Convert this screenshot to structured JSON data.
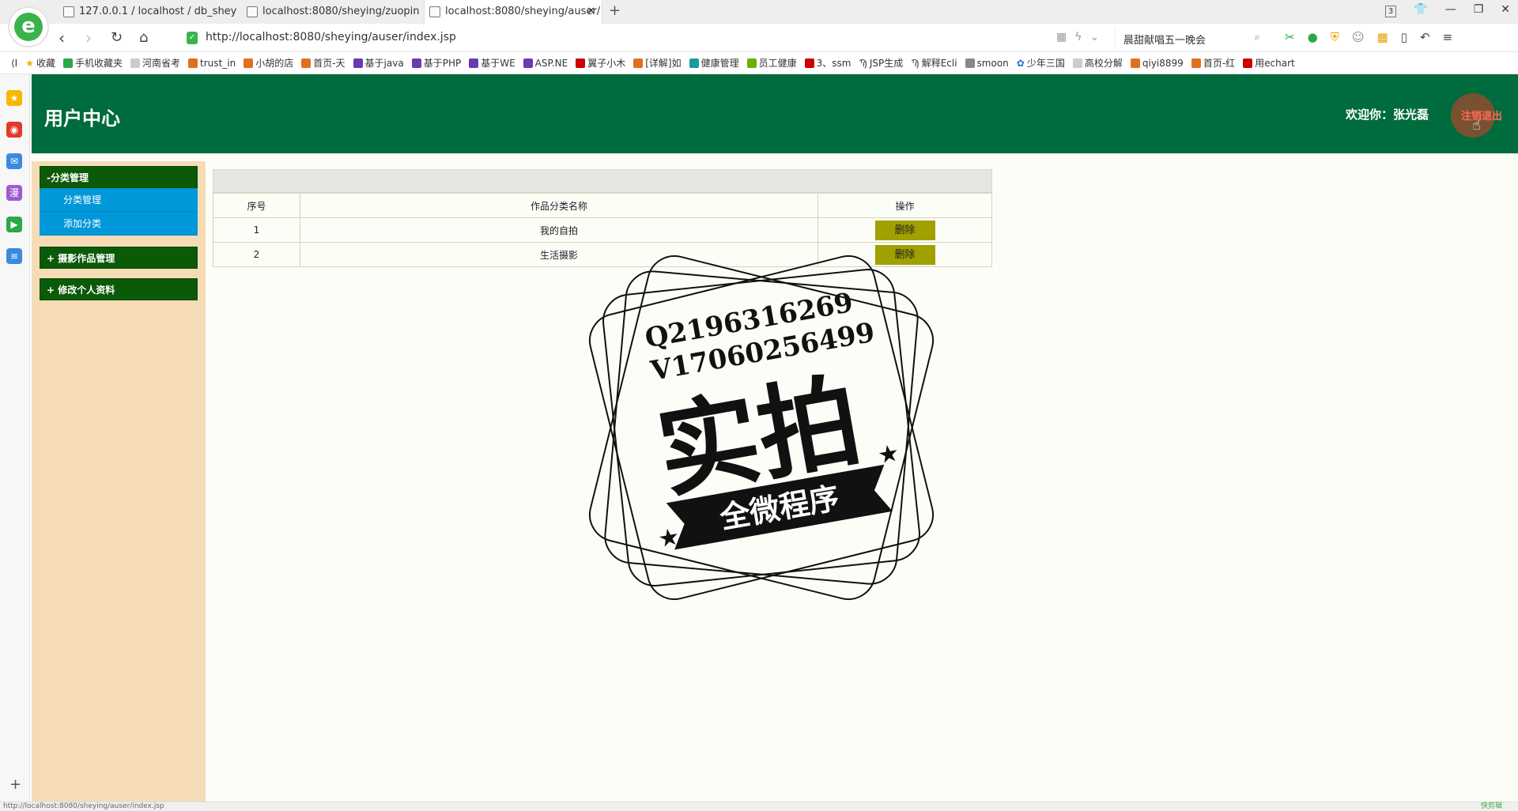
{
  "browser": {
    "tabs": [
      {
        "title": "127.0.0.1 / localhost / db_shey"
      },
      {
        "title": "localhost:8080/sheying/zuopin"
      },
      {
        "title": "localhost:8080/sheying/auser/"
      }
    ],
    "tab_count": "3",
    "url": "http://localhost:8080/sheying/auser/index.jsp",
    "search_text": "晨甜献唱五一晚会",
    "bookmarks": [
      "收藏",
      "手机收藏夹",
      "河南省考",
      "trust_in",
      "小胡的店",
      "首页-天",
      "基于java",
      "基于PHP",
      "基于WE",
      "ASP.NE",
      "翼子小木",
      "[详解]如",
      "健康管理",
      "员工健康",
      "3、ssm",
      "JSP生成",
      "解释Ecli",
      "smoon",
      "少年三国",
      "高校分解",
      "qiyi8899",
      "首页-红",
      "用echart"
    ],
    "status_text": "http://localhost:8080/sheying/auser/index.jsp",
    "status_right": "快剪辑"
  },
  "header": {
    "title": "用户中心",
    "welcome": "欢迎你：张光磊",
    "logout": "注销退出"
  },
  "sidebar": {
    "groups": [
      {
        "label": "-分类管理",
        "items": [
          "分类管理",
          "添加分类"
        ]
      },
      {
        "label": "+ 摄影作品管理"
      },
      {
        "label": "+ 修改个人资料"
      }
    ]
  },
  "table": {
    "columns": [
      "序号",
      "作品分类名称",
      "操作"
    ],
    "rows": [
      {
        "index": "1",
        "name": "我的自拍",
        "action": "删除"
      },
      {
        "index": "2",
        "name": "生活摄影",
        "action": "删除"
      }
    ]
  },
  "watermark": {
    "line1": "Q2196316269",
    "line2": "V17060256499",
    "main": "实拍",
    "banner": "全微程序"
  },
  "colors": {
    "header_bg": "#006b3c",
    "sidebar_bg": "#f5dcb7",
    "menu_head_bg": "#0b5a08",
    "submenu_bg": "#0098d8",
    "delete_btn_bg": "#a0a000"
  }
}
